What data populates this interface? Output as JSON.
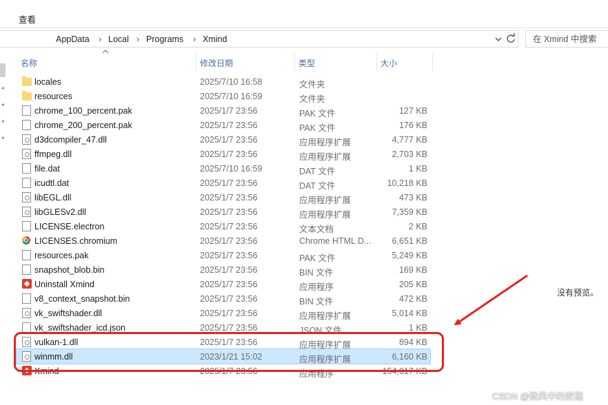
{
  "ribbon": {
    "view_tab": "查看"
  },
  "address": {
    "crumbs": [
      "AppData",
      "Local",
      "Programs",
      "Xmind"
    ],
    "separator": "›"
  },
  "search": {
    "placeholder": "在 Xmind 中搜索"
  },
  "columns": {
    "name": "名称",
    "modified": "修改日期",
    "type": "类型",
    "size": "大小"
  },
  "files": [
    {
      "name": "locales",
      "date": "2025/7/10 16:58",
      "type": "文件夹",
      "size": "",
      "icon": "folder-icon"
    },
    {
      "name": "resources",
      "date": "2025/7/10 16:59",
      "type": "文件夹",
      "size": "",
      "icon": "folder-icon"
    },
    {
      "name": "chrome_100_percent.pak",
      "date": "2025/1/7 23:56",
      "type": "PAK 文件",
      "size": "127 KB",
      "icon": "file-icon"
    },
    {
      "name": "chrome_200_percent.pak",
      "date": "2025/1/7 23:56",
      "type": "PAK 文件",
      "size": "176 KB",
      "icon": "file-icon"
    },
    {
      "name": "d3dcompiler_47.dll",
      "date": "2025/1/7 23:56",
      "type": "应用程序扩展",
      "size": "4,777 KB",
      "icon": "dll-icon"
    },
    {
      "name": "ffmpeg.dll",
      "date": "2025/1/7 23:56",
      "type": "应用程序扩展",
      "size": "2,703 KB",
      "icon": "dll-icon"
    },
    {
      "name": "file.dat",
      "date": "2025/7/10 16:59",
      "type": "DAT 文件",
      "size": "1 KB",
      "icon": "file-icon"
    },
    {
      "name": "icudtl.dat",
      "date": "2025/1/7 23:56",
      "type": "DAT 文件",
      "size": "10,218 KB",
      "icon": "file-icon"
    },
    {
      "name": "libEGL.dll",
      "date": "2025/1/7 23:56",
      "type": "应用程序扩展",
      "size": "473 KB",
      "icon": "dll-icon"
    },
    {
      "name": "libGLESv2.dll",
      "date": "2025/1/7 23:56",
      "type": "应用程序扩展",
      "size": "7,359 KB",
      "icon": "dll-icon"
    },
    {
      "name": "LICENSE.electron",
      "date": "2025/1/7 23:56",
      "type": "文本文档",
      "size": "2 KB",
      "icon": "file-icon"
    },
    {
      "name": "LICENSES.chromium",
      "date": "2025/1/7 23:56",
      "type": "Chrome HTML D...",
      "size": "6,651 KB",
      "icon": "chrome-icon"
    },
    {
      "name": "resources.pak",
      "date": "2025/1/7 23:56",
      "type": "PAK 文件",
      "size": "5,249 KB",
      "icon": "file-icon"
    },
    {
      "name": "snapshot_blob.bin",
      "date": "2025/1/7 23:56",
      "type": "BIN 文件",
      "size": "169 KB",
      "icon": "file-icon"
    },
    {
      "name": "Uninstall Xmind",
      "date": "2025/1/7 23:56",
      "type": "应用程序",
      "size": "205 KB",
      "icon": "app-icon"
    },
    {
      "name": "v8_context_snapshot.bin",
      "date": "2025/1/7 23:56",
      "type": "BIN 文件",
      "size": "472 KB",
      "icon": "file-icon"
    },
    {
      "name": "vk_swiftshader.dll",
      "date": "2025/1/7 23:56",
      "type": "应用程序扩展",
      "size": "5,014 KB",
      "icon": "dll-icon"
    },
    {
      "name": "vk_swiftshader_icd.json",
      "date": "2025/1/7 23:56",
      "type": "JSON 文件",
      "size": "1 KB",
      "icon": "file-icon"
    },
    {
      "name": "vulkan-1.dll",
      "date": "2025/1/7 23:56",
      "type": "应用程序扩展",
      "size": "894 KB",
      "icon": "dll-icon"
    },
    {
      "name": "winmm.dll",
      "date": "2023/1/21 15:02",
      "type": "应用程序扩展",
      "size": "6,160 KB",
      "icon": "dll-icon",
      "selected": true
    },
    {
      "name": "Xmind",
      "date": "2025/1/7 23:56",
      "type": "应用程序",
      "size": "154,017 KB",
      "icon": "app-icon"
    }
  ],
  "preview": {
    "text": "没有预览。"
  },
  "annotation": {
    "color": "#e8221c"
  },
  "watermark": {
    "text": "CSDN @微风中的麦穗"
  }
}
